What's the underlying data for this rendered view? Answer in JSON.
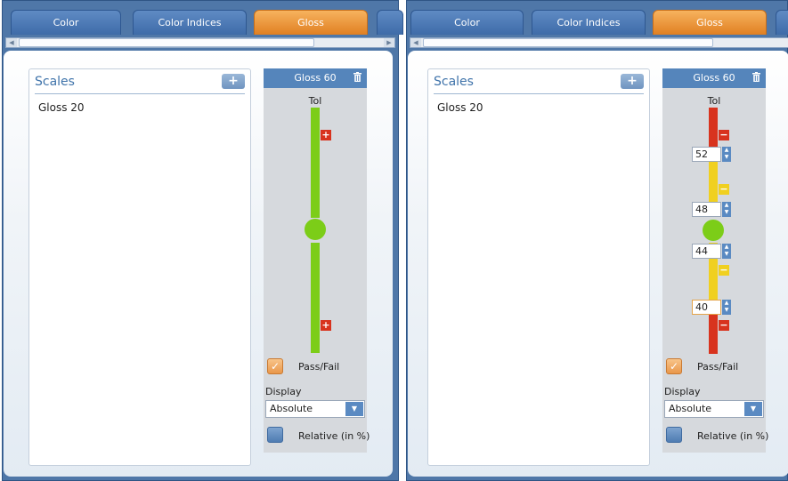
{
  "tabs": [
    "Color",
    "Color Indices",
    "Gloss"
  ],
  "scales": {
    "title": "Scales",
    "add_symbol": "+",
    "items": [
      "Gloss 20"
    ]
  },
  "gloss": {
    "title": "Gloss 60",
    "tol_label": "Tol",
    "pass_fail": "Pass/Fail",
    "display_label": "Display",
    "display_value": "Absolute",
    "relative_label": "Relative (in %)"
  },
  "left_panel": {
    "tolerance_state": "add"
  },
  "right_panel": {
    "spinner_values": [
      "52",
      "48",
      "44",
      "40"
    ]
  },
  "colors": {
    "accent_tab": "#e8892c",
    "green": "#7ccd18",
    "yellow": "#f0d020",
    "red": "#d8331e",
    "blue": "#5585bb"
  },
  "icons": {
    "add": "plus-icon",
    "delete": "trash-icon",
    "spin": "spinner-arrows-icon",
    "dropdown": "chevron-down-icon",
    "check": "checkmark-icon"
  }
}
